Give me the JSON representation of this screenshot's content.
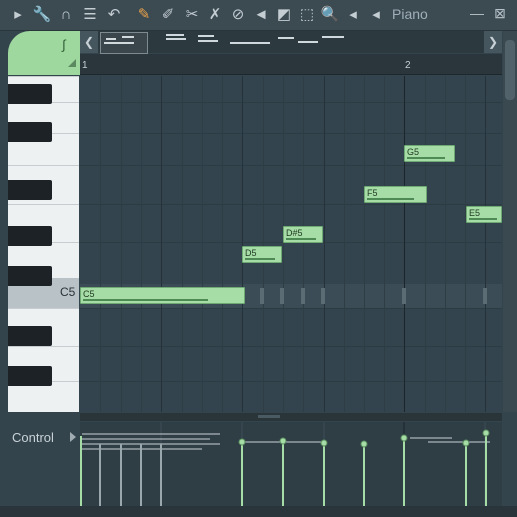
{
  "toolbar": {
    "instrument_label": "Piano",
    "icons": [
      {
        "name": "play-arrow-icon",
        "glyph": "▸"
      },
      {
        "name": "wrench-icon",
        "glyph": "🔧"
      },
      {
        "name": "magnet-icon",
        "glyph": "∩"
      },
      {
        "name": "menu-circle-icon",
        "glyph": "☰"
      },
      {
        "name": "undo-icon",
        "glyph": "↶"
      },
      {
        "name": "pencil-icon",
        "glyph": "✎",
        "accent": true
      },
      {
        "name": "paint-brush-icon",
        "glyph": "✐"
      },
      {
        "name": "delete-tool-icon",
        "glyph": "✂"
      },
      {
        "name": "erase-tool-icon",
        "glyph": "✗"
      },
      {
        "name": "mute-tool-icon",
        "glyph": "⊘"
      },
      {
        "name": "speaker-mute-icon",
        "glyph": "◄"
      },
      {
        "name": "slice-tool-icon",
        "glyph": "◩"
      },
      {
        "name": "select-tool-icon",
        "glyph": "⬚"
      },
      {
        "name": "zoom-icon",
        "glyph": "🔍"
      },
      {
        "name": "playback-tool-icon",
        "glyph": "◂"
      },
      {
        "name": "speaker-icon",
        "glyph": "◂"
      }
    ],
    "minimize_glyph": "—",
    "close_glyph": "⊠"
  },
  "corner": {
    "wave_glyph": "∫"
  },
  "navigation": {
    "left_glyph": "❮",
    "right_glyph": "❯"
  },
  "ruler": {
    "bars": [
      "1",
      "2"
    ]
  },
  "keyboard": {
    "marked_key": "C5"
  },
  "notes": [
    {
      "label": "C5",
      "velocity": 0.78
    },
    {
      "label": "D5",
      "velocity": 0.78
    },
    {
      "label": "D#5",
      "velocity": 0.78
    },
    {
      "label": "F5",
      "velocity": 0.78
    },
    {
      "label": "G5",
      "velocity": 0.78
    },
    {
      "label": "E5",
      "velocity": 0.78
    }
  ],
  "control": {
    "label": "Control"
  },
  "colors": {
    "note_fill": "#a6dca6",
    "accent": "#e8a24a",
    "grid_bg": "#34444e"
  }
}
